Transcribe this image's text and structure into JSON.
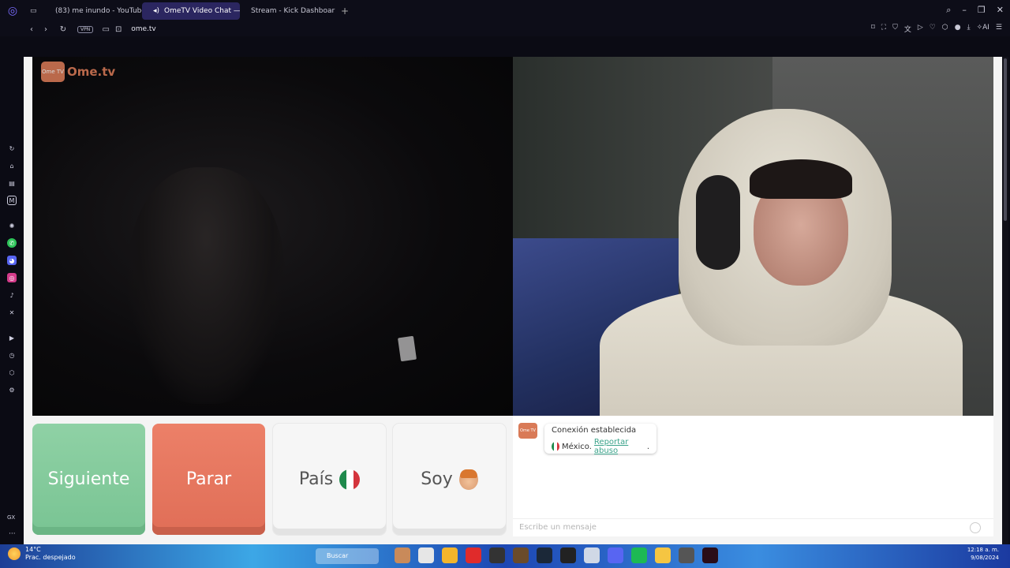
{
  "browser": {
    "tabs": [
      {
        "label": "(83) me inundo - YouTube",
        "color": "#e02b2b"
      },
      {
        "label": "OmeTV Video Chat — ",
        "color": "#d97a57",
        "active": true
      },
      {
        "label": "Stream - Kick Dashboar",
        "color": "#2ed150"
      }
    ],
    "new_tab": "+",
    "vpn_label": "VPN",
    "url": "ome.tv",
    "ai_label": "AI"
  },
  "sidebar": {
    "gx_label": "GX",
    "more": "···"
  },
  "ome": {
    "logo_tv": "Ome TV",
    "logo_text": "Ome.tv"
  },
  "controls": {
    "next_label": "Siguiente",
    "stop_label": "Parar",
    "country_label": "País",
    "gender_label": "Soy"
  },
  "chat": {
    "logo_text": "Ome TV",
    "status": "Conexión establecida",
    "country": "México.",
    "report_link": "Reportar abuso",
    "report_suffix": ".",
    "placeholder": "Escribe un mensaje"
  },
  "taskbar": {
    "temperature": "14°C",
    "weather_desc": "Prac. despejado",
    "search_label": "Buscar",
    "time": "12:18 a. m.",
    "date": "9/08/2024"
  },
  "colors": {
    "next": "#79c493",
    "stop": "#e06e57",
    "brand": "#d97a57",
    "report_link": "#3aa38a"
  }
}
